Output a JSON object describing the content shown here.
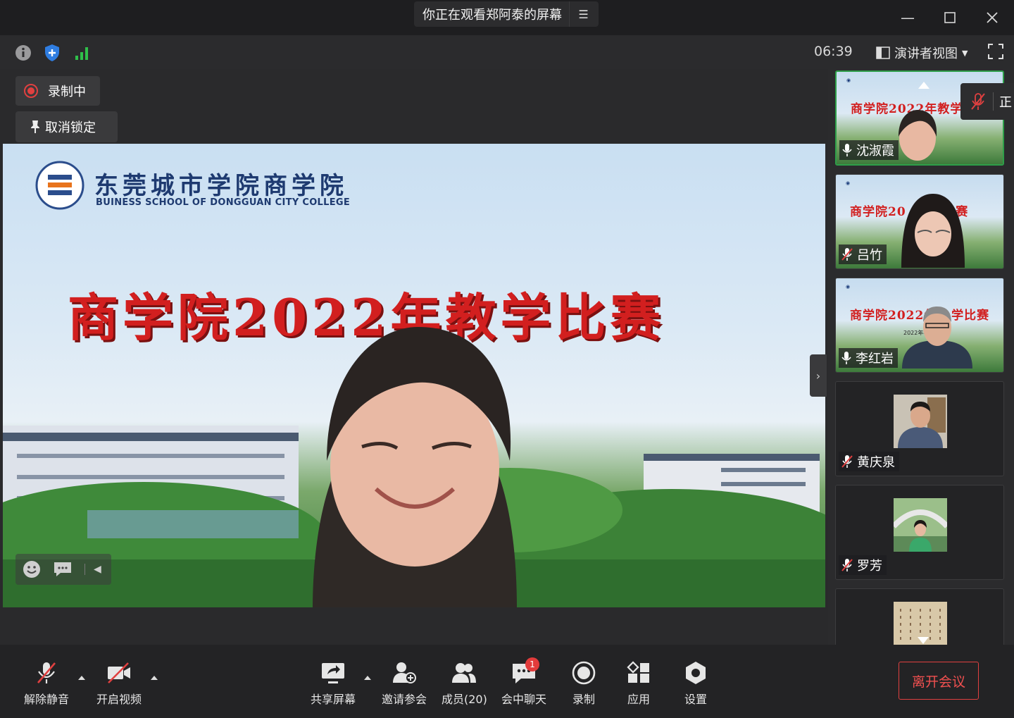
{
  "titlebar": {
    "watching": "你正在观看郑阿泰的屏幕"
  },
  "toolbar": {
    "timer": "06:39",
    "view_label": "演讲者视图"
  },
  "main": {
    "recording_label": "录制中",
    "unpin_label": "取消锁定"
  },
  "slide": {
    "school_cn": "东莞城市学院商学院",
    "school_en": "BUINESS SCHOOL OF DONGGUAN CITY COLLEGE",
    "title": "商学院2022年教学比赛"
  },
  "participants": [
    {
      "name": "沈淑霞",
      "muted": false
    },
    {
      "name": "吕竹",
      "muted": true
    },
    {
      "name": "李红岩",
      "muted": false
    },
    {
      "name": "黄庆泉",
      "muted": true
    },
    {
      "name": "罗芳",
      "muted": true
    }
  ],
  "thumb_titles": {
    "t1": "商学院2022年教学",
    "t2": "商学院20     学比赛",
    "t3": "商学院2022年   学比赛",
    "t3_date": "2022年4月"
  },
  "floating": {
    "text": "正"
  },
  "bottom": {
    "unmute": "解除静音",
    "start_video": "开启视频",
    "share": "共享屏幕",
    "invite": "邀请参会",
    "members": "成员(20)",
    "chat": "会中聊天",
    "chat_badge": "1",
    "record": "录制",
    "apps": "应用",
    "settings": "设置",
    "leave": "离开会议"
  },
  "colors": {
    "accent_green": "#2e9e49",
    "danger": "#e04040",
    "slide_red": "#d21f1f"
  }
}
